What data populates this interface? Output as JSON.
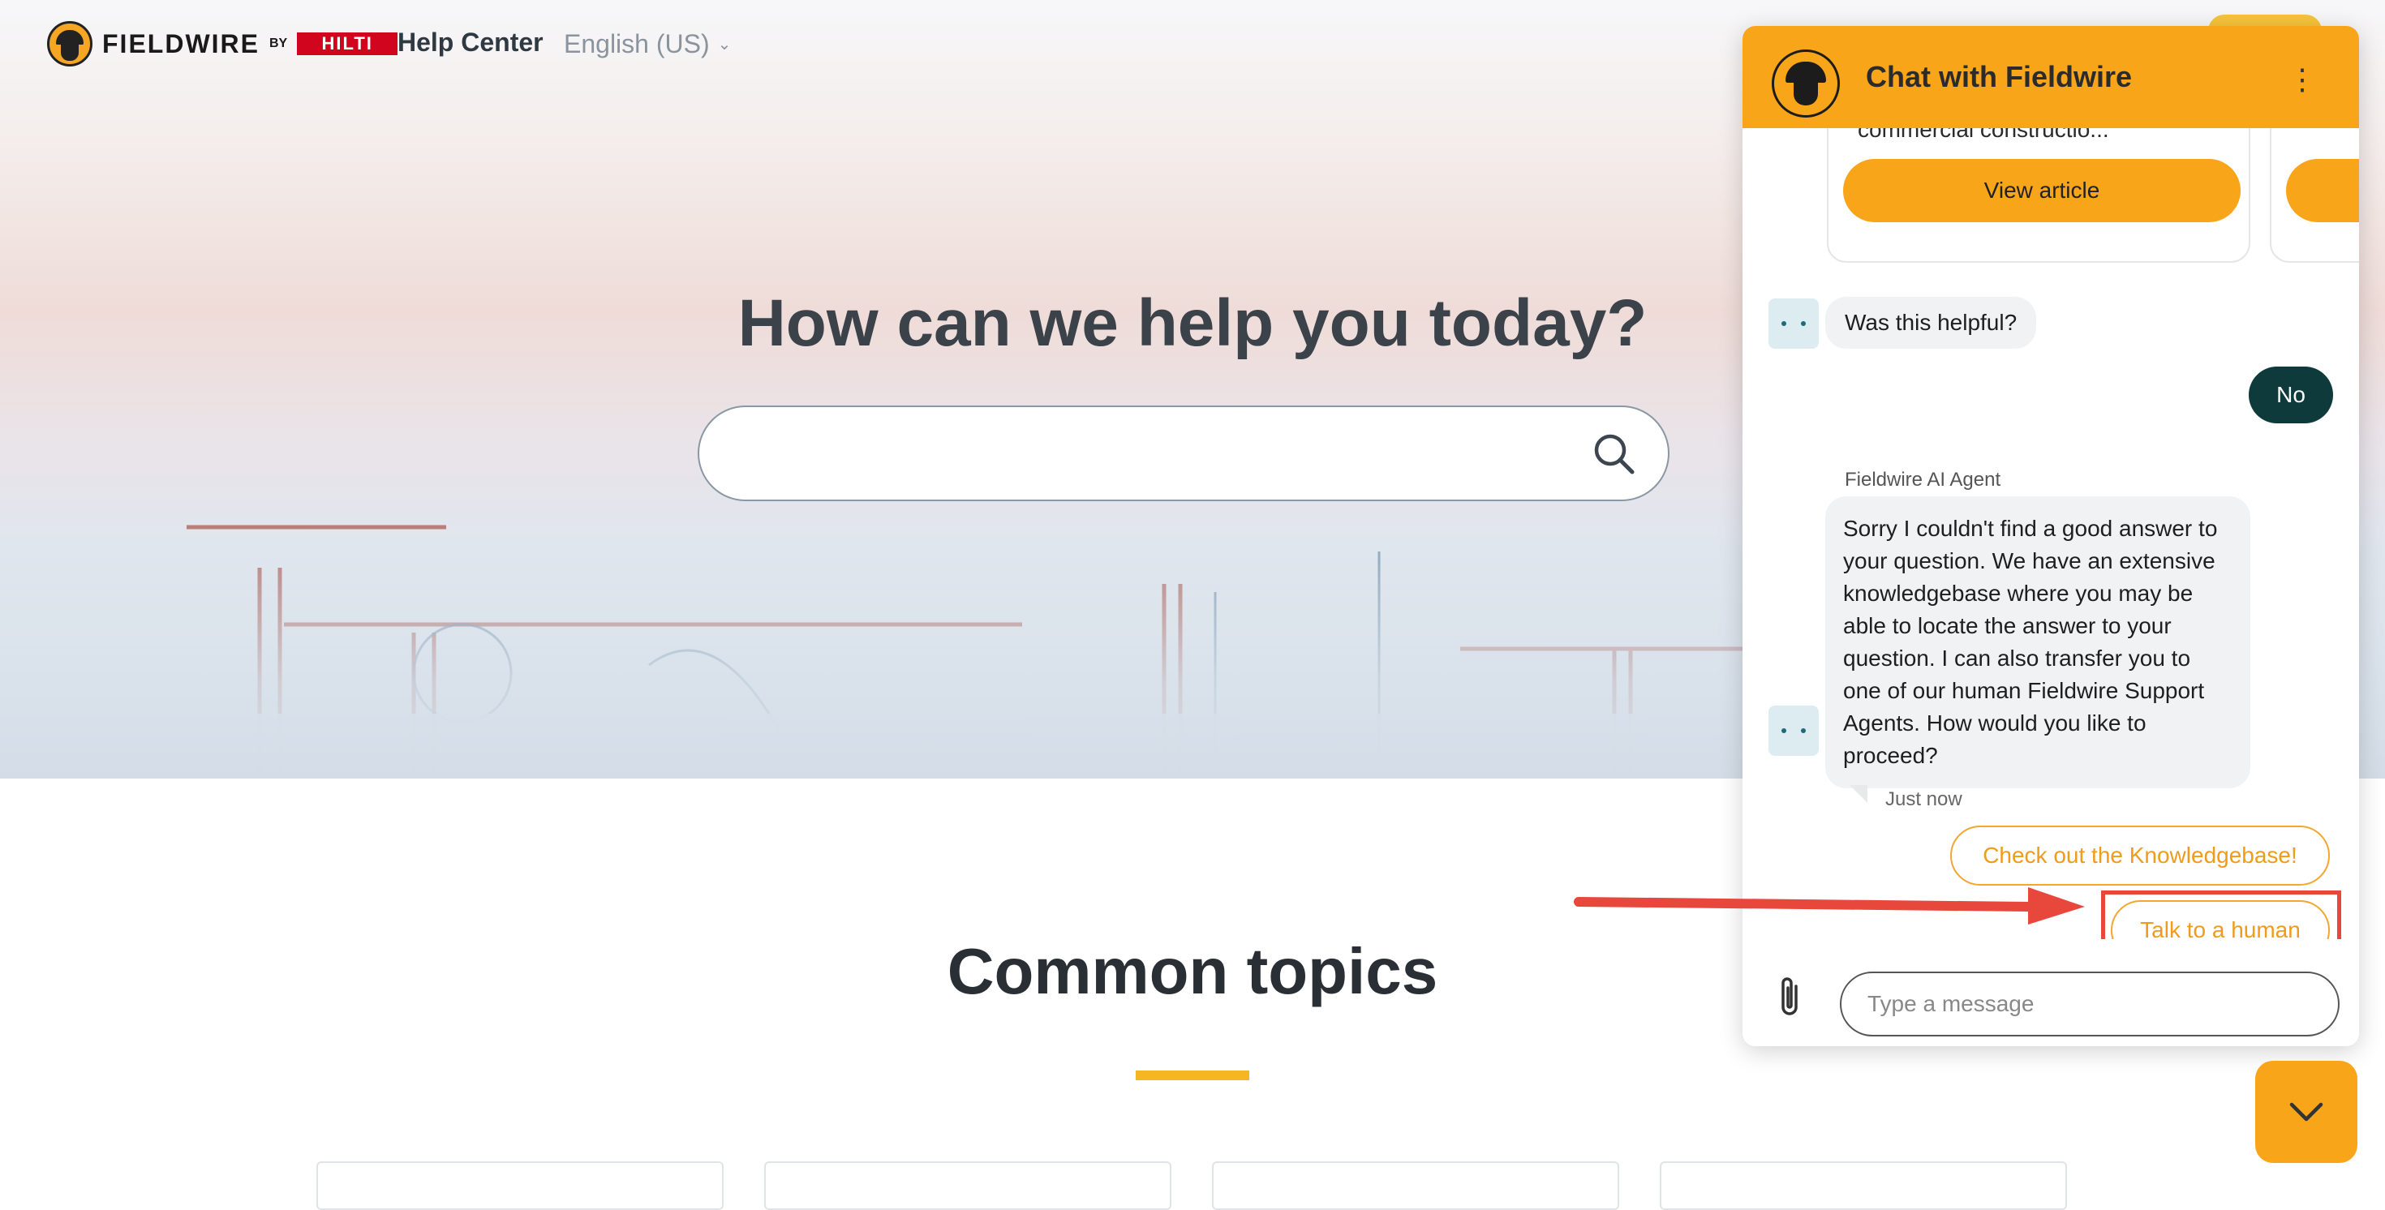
{
  "header": {
    "logo_text": "FIELDWIRE",
    "logo_by": "BY",
    "partner_logo": "HILTI",
    "help_center": "Help Center",
    "language": "English (US)"
  },
  "hero": {
    "title": "How can we help you today?",
    "search_placeholder": ""
  },
  "main": {
    "section_title": "Common topics"
  },
  "chat": {
    "title": "Chat with Fieldwire",
    "article_snippet": "commercial constructio...",
    "view_article_label": "View article",
    "helpful_question": "Was this helpful?",
    "user_reply": "No",
    "agent_name": "Fieldwire AI Agent",
    "agent_message": "Sorry I couldn't find a good answer to your question. We have an extensive knowledgebase where you may be able to locate the answer to your question. I can also transfer you to one of our human Fieldwire Support Agents. How would you like to proceed?",
    "timestamp": "Just now",
    "quick_replies": [
      "Check out the Knowledgebase!",
      "Talk to a human"
    ],
    "input_placeholder": "Type a message"
  },
  "colors": {
    "brand_orange": "#f9a51a",
    "user_bubble": "#0e3a3b",
    "highlight_red": "#e8473c"
  }
}
